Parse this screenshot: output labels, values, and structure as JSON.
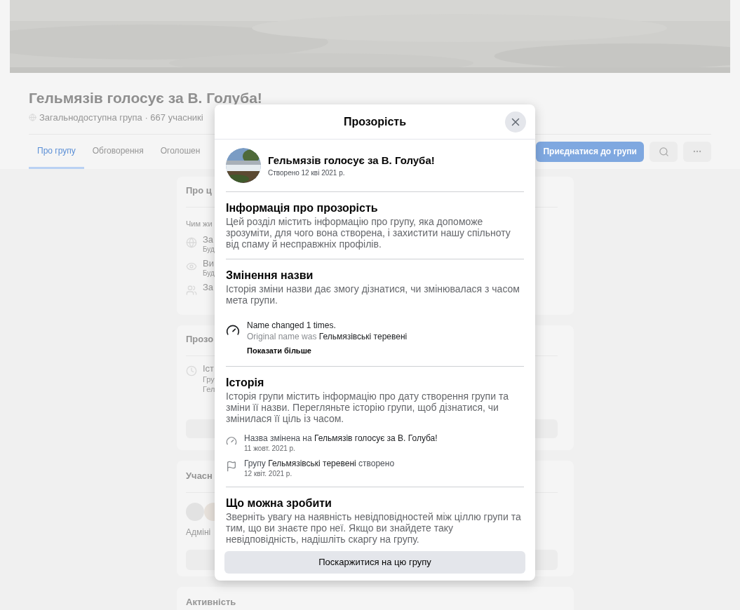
{
  "page": {
    "group_title": "Гельмязів голосує за В. Голуба!",
    "group_meta": "Загальнодоступна група · 667 учасникі",
    "tabs": [
      {
        "label": "Про групу",
        "selected": true
      },
      {
        "label": "Обговорення",
        "selected": false
      },
      {
        "label": "Оголошен",
        "selected": false
      }
    ],
    "join_button": "Приєднатися до групи",
    "about_card": {
      "title": "Про ц",
      "subtitle": "Чим жи",
      "items": [
        {
          "kind": "globe",
          "label": "За",
          "detail": "Буд"
        },
        {
          "kind": "eye",
          "label": "Ви",
          "detail": "Буд"
        },
        {
          "kind": "people",
          "label": "За"
        }
      ]
    },
    "transparency_card": {
      "title": "Прозо",
      "item": {
        "label": "Іст",
        "lines": [
          "Гру",
          "Гел"
        ]
      }
    },
    "members_card": {
      "title": "Учасн",
      "caption": "Адміні"
    },
    "activity_card": {
      "title": "Активність"
    }
  },
  "dialog": {
    "title": "Прозорість",
    "group": {
      "name": "Гельмязів голосує за В. Голуба!",
      "created": "Створено 12 кві 2021 р."
    },
    "sections": [
      {
        "kind": "text",
        "heading": "Інформація про прозорість",
        "body": "Цей розділ містить інформацію про групу, яка допоможе зрозуміти, для чого вона створена, і захистити нашу спільноту від спаму й несправжніх профілів."
      },
      {
        "kind": "name_changes",
        "heading": "Змінення назви",
        "body": "Історія зміни назви дає змогу дізнатися, чи змінювалася з часом мета групи.",
        "summary": "Name changed 1 times.",
        "original": "Original name was **Гельмязівські теревені**",
        "more": "Показати більше"
      },
      {
        "kind": "history",
        "heading": "Історія",
        "body": "Історія групи містить інформацію про дату створення групи та зміни її назви. Перегляньте історію групи, щоб дізнатися, чи змінилася її ціль із часом.",
        "events": [
          {
            "kind": "renamed",
            "text": "Назва змінена на **Гельмязів голосує за В. Голуба!**",
            "date": "11 жовт. 2021 р."
          },
          {
            "kind": "created",
            "text": "Групу **Гельмязівські теревені** створено",
            "date": "12 квіт. 2021 р."
          }
        ]
      },
      {
        "kind": "text",
        "heading": "Що можна зробити",
        "body": "Зверніть увагу на наявність невідповідностей між ціллю групи та тим, що ви знаєте про неї. Якщо ви знайдете таку невідповідність, надішліть скаргу на групу."
      }
    ],
    "report_button": "Поскаржитися на цю групу"
  }
}
